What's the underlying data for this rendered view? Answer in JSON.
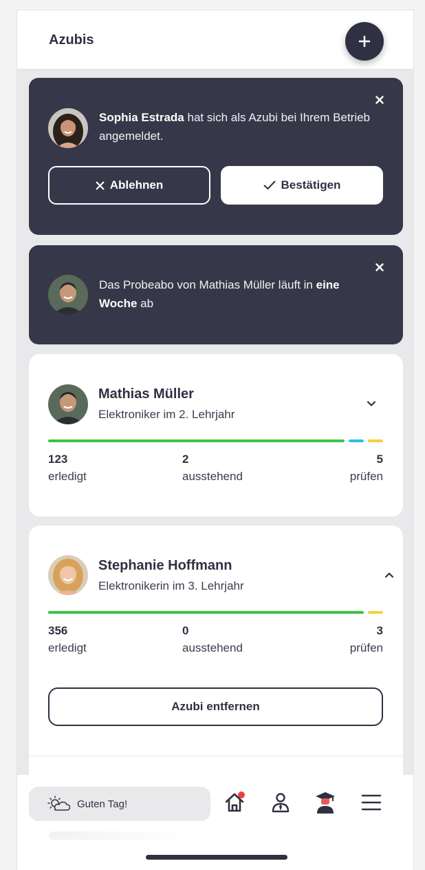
{
  "header": {
    "title": "Azubis"
  },
  "notifications": [
    {
      "name": "Sophia Estrada",
      "text_after_name": " hat sich als Azubi bei Ihrem Betrieb angemeldet.",
      "reject_label": "Ablehnen",
      "confirm_label": "Bestätigen"
    },
    {
      "text_before": "Das Probeabo von Mathias Müller läuft in ",
      "bold": "eine Woche",
      "text_after": " ab"
    }
  ],
  "trainees": [
    {
      "name": "Mathias Müller",
      "role": "Elektroniker im 2. Lehrjahr",
      "done": "123",
      "done_label": "erledigt",
      "pending": "2",
      "pending_label": "ausstehend",
      "review": "5",
      "review_label": "prüfen",
      "progress": {
        "done": 123,
        "pending": 2,
        "review": 5
      },
      "expanded": false
    },
    {
      "name": "Stephanie Hoffmann",
      "role": "Elektronikerin im 3. Lehrjahr",
      "done": "356",
      "done_label": "erledigt",
      "pending": "0",
      "pending_label": "ausstehend",
      "review": "3",
      "review_label": "prüfen",
      "progress": {
        "done": 356,
        "pending": 0,
        "review": 3
      },
      "expanded": true,
      "remove_label": "Azubi entfernen"
    }
  ],
  "bottom_nav": {
    "greeting": "Guten Tag!",
    "icons": [
      "home-icon",
      "trainer-icon",
      "graduate-icon",
      "menu-icon"
    ]
  },
  "colors": {
    "dark": "#363849",
    "done": "#3cc243",
    "pending": "#2ebde8",
    "review": "#f6d03c",
    "notification_dot": "#f0403c"
  }
}
